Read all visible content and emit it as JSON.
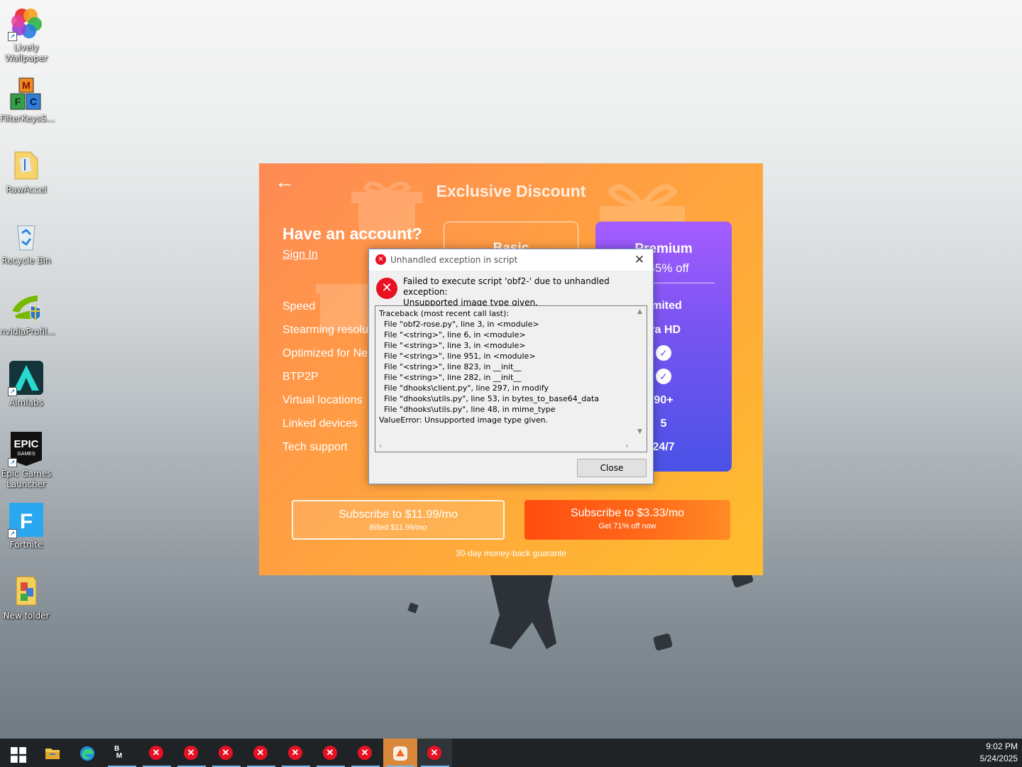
{
  "desktop": {
    "icons": [
      {
        "label": "Lively Wallpaper"
      },
      {
        "label": "FilterKeysS..."
      },
      {
        "label": "RawAccel"
      },
      {
        "label": "Recycle Bin"
      },
      {
        "label": "nvidiaProfil..."
      },
      {
        "label": "Aimlabs"
      },
      {
        "label": "Epic Games Launcher",
        "art": "EPIC GAMES"
      },
      {
        "label": "Fortnite",
        "art": "F"
      },
      {
        "label": "New folder"
      }
    ]
  },
  "vpn_app": {
    "back_icon": "←",
    "title": "Exclusive Discount",
    "account_heading": "Have an account?",
    "sign_in": "Sign In",
    "features": [
      "Speed",
      "Stearming resolut",
      "Optimized for Ne",
      "BTP2P",
      "Virtual locations",
      "Linked devices",
      "Tech support"
    ],
    "basic_plan": {
      "name": "Basic"
    },
    "premium_plan": {
      "name": "Premium",
      "offer": "o 65% off",
      "values": [
        "limited",
        "tra HD",
        "✓",
        "✓",
        "90+",
        "5",
        "24/7"
      ]
    },
    "subscribe_basic": {
      "main": "Subscribe to $11.99/mo",
      "sub": "Billed $11.99/mo"
    },
    "subscribe_premium": {
      "main": "Subscribe to $3.33/mo",
      "sub": "Get 71% off now"
    },
    "guarantee": "30-day money-back guarante"
  },
  "error_dialog": {
    "title": "Unhandled exception in script",
    "message_line1": "Failed to execute script 'obf2-' due to unhandled exception:",
    "message_line2": "Unsupported image type given.",
    "traceback": [
      "Traceback (most recent call last):",
      "  File \"obf2-rose.py\", line 3, in <module>",
      "  File \"<string>\", line 6, in <module>",
      "  File \"<string>\", line 3, in <module>",
      "  File \"<string>\", line 951, in <module>",
      "  File \"<string>\", line 823, in __init__",
      "  File \"<string>\", line 282, in __init__",
      "  File \"dhooks\\client.py\", line 297, in modify",
      "  File \"dhooks\\utils.py\", line 53, in bytes_to_base64_data",
      "  File \"dhooks\\utils.py\", line 48, in mime_type",
      "ValueError: Unsupported image type given."
    ],
    "close_label": "Close",
    "title_close": "✕"
  },
  "taskbar": {
    "time": "9:02 PM",
    "date": "5/24/2025",
    "error_glyph": "✕"
  },
  "colors": {
    "error_red": "#e81123",
    "premium_purple": "#7654f0",
    "taskbar": "#1f2326"
  }
}
